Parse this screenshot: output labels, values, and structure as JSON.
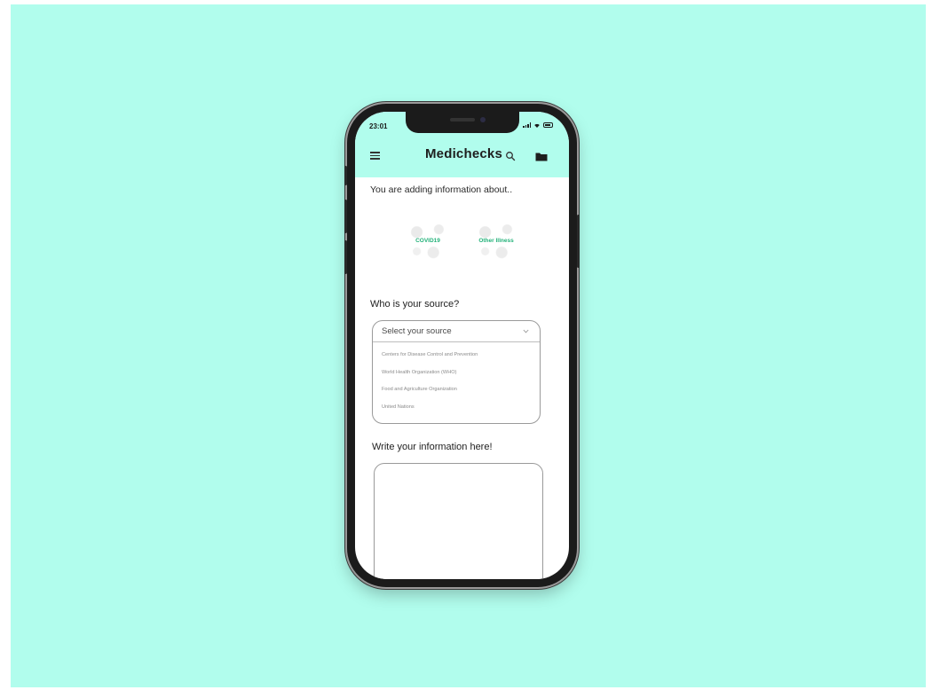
{
  "status_bar": {
    "time": "23:01"
  },
  "app_bar": {
    "title": "Medichecks",
    "menu_icon": "hamburger-menu-icon",
    "search_icon": "search-icon",
    "folder_icon": "folder-icon",
    "background": "#b1fded"
  },
  "adding_section": {
    "heading": "You are adding information about..",
    "topics": [
      {
        "label": "COVID19"
      },
      {
        "label": "Other Illness"
      }
    ],
    "accent": "#24b27a"
  },
  "source_section": {
    "heading": "Who is your source?",
    "select_placeholder": "Select your source",
    "options": [
      "Centers for Disease Control and Prevention",
      "World Health Organization (WHO)",
      "Food and Agriculture Organization",
      "United Nations"
    ]
  },
  "write_section": {
    "heading": "Write your information here!",
    "textarea_value": ""
  }
}
